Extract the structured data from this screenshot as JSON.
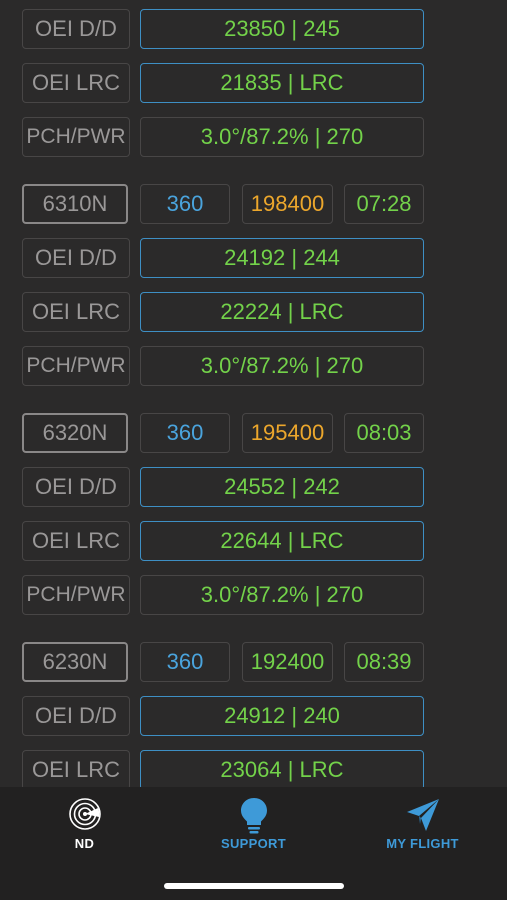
{
  "colors": {
    "background": "#2b2a2a",
    "green_value": "#73d24a",
    "blue_value": "#4aa4dd",
    "orange_value": "#eca72c",
    "label_gray": "#9a9898",
    "accent_blue": "#3e8fc4"
  },
  "top_rows": [
    {
      "label": "OEI D/D",
      "value": "23850 | 245"
    },
    {
      "label": "OEI LRC",
      "value": "21835 | LRC"
    },
    {
      "label": "PCH/PWR",
      "value": "3.0°/87.2% | 270"
    }
  ],
  "groups": [
    {
      "header": {
        "label": "6310N",
        "heading": "360",
        "weight": "198400",
        "weight_color": "#eca72c",
        "time": "07:28"
      },
      "rows": [
        {
          "label": "OEI D/D",
          "value": "24192 | 244"
        },
        {
          "label": "OEI LRC",
          "value": "22224 | LRC"
        },
        {
          "label": "PCH/PWR",
          "value": "3.0°/87.2% | 270"
        }
      ]
    },
    {
      "header": {
        "label": "6320N",
        "heading": "360",
        "weight": "195400",
        "weight_color": "#eca72c",
        "time": "08:03"
      },
      "rows": [
        {
          "label": "OEI D/D",
          "value": "24552 | 242"
        },
        {
          "label": "OEI LRC",
          "value": "22644 | LRC"
        },
        {
          "label": "PCH/PWR",
          "value": "3.0°/87.2% | 270"
        }
      ]
    },
    {
      "header": {
        "label": "6230N",
        "heading": "360",
        "weight": "192400",
        "weight_color": "#73d24a",
        "time": "08:39"
      },
      "rows": [
        {
          "label": "OEI D/D",
          "value": "24912 | 240"
        },
        {
          "label": "OEI LRC",
          "value": "23064 | LRC"
        }
      ]
    }
  ],
  "tabbar": {
    "tabs": [
      {
        "label": "ND",
        "icon": "radar-icon",
        "color": "#ffffff",
        "active": true
      },
      {
        "label": "SUPPORT",
        "icon": "lightbulb-icon",
        "color": "#3e9ad8",
        "active": false
      },
      {
        "label": "MY FLIGHT",
        "icon": "paper-plane-icon",
        "color": "#3e9ad8",
        "active": false
      }
    ]
  }
}
